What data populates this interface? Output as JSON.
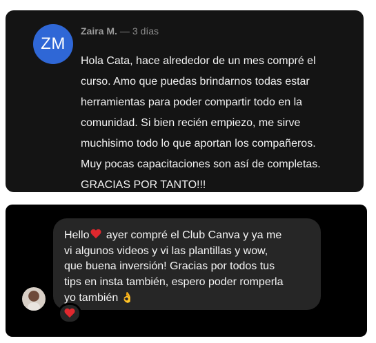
{
  "comment": {
    "avatar_initials": "ZM",
    "author": "Zaira M.",
    "separator": "—",
    "time": "3 días",
    "body": "Hola Cata, hace alrededor de un mes compré el\ncurso. Amo que puedas brindarnos todas estar\nherramientas para poder compartir todo en la\ncomunidad. Si bien recién empiezo, me sirve\nmuchisimo todo lo que aportan los compañeros.\nMuy pocas capacitaciones son así de completas.\nGRACIAS POR TANTO!!!",
    "colors": {
      "card": "#141414",
      "avatar": "#2f67d6"
    }
  },
  "dm": {
    "avatar_icon": "profile-photo",
    "text_start": "Hello",
    "inline_emoji": "red-heart-icon",
    "text_rest": " ayer compré el Club Canva y ya me\nvi algunos videos y vi las plantillas y wow,\nque buena inversión! Gracias por todos tus\ntips en insta también, espero poder romperla\nyo también",
    "trailing_emoji": "ok-hand-icon",
    "trailing_emoji_glyph": "👌",
    "reaction": "red-heart-icon",
    "colors": {
      "bubble": "#262626",
      "heart": "#e0282e"
    }
  }
}
